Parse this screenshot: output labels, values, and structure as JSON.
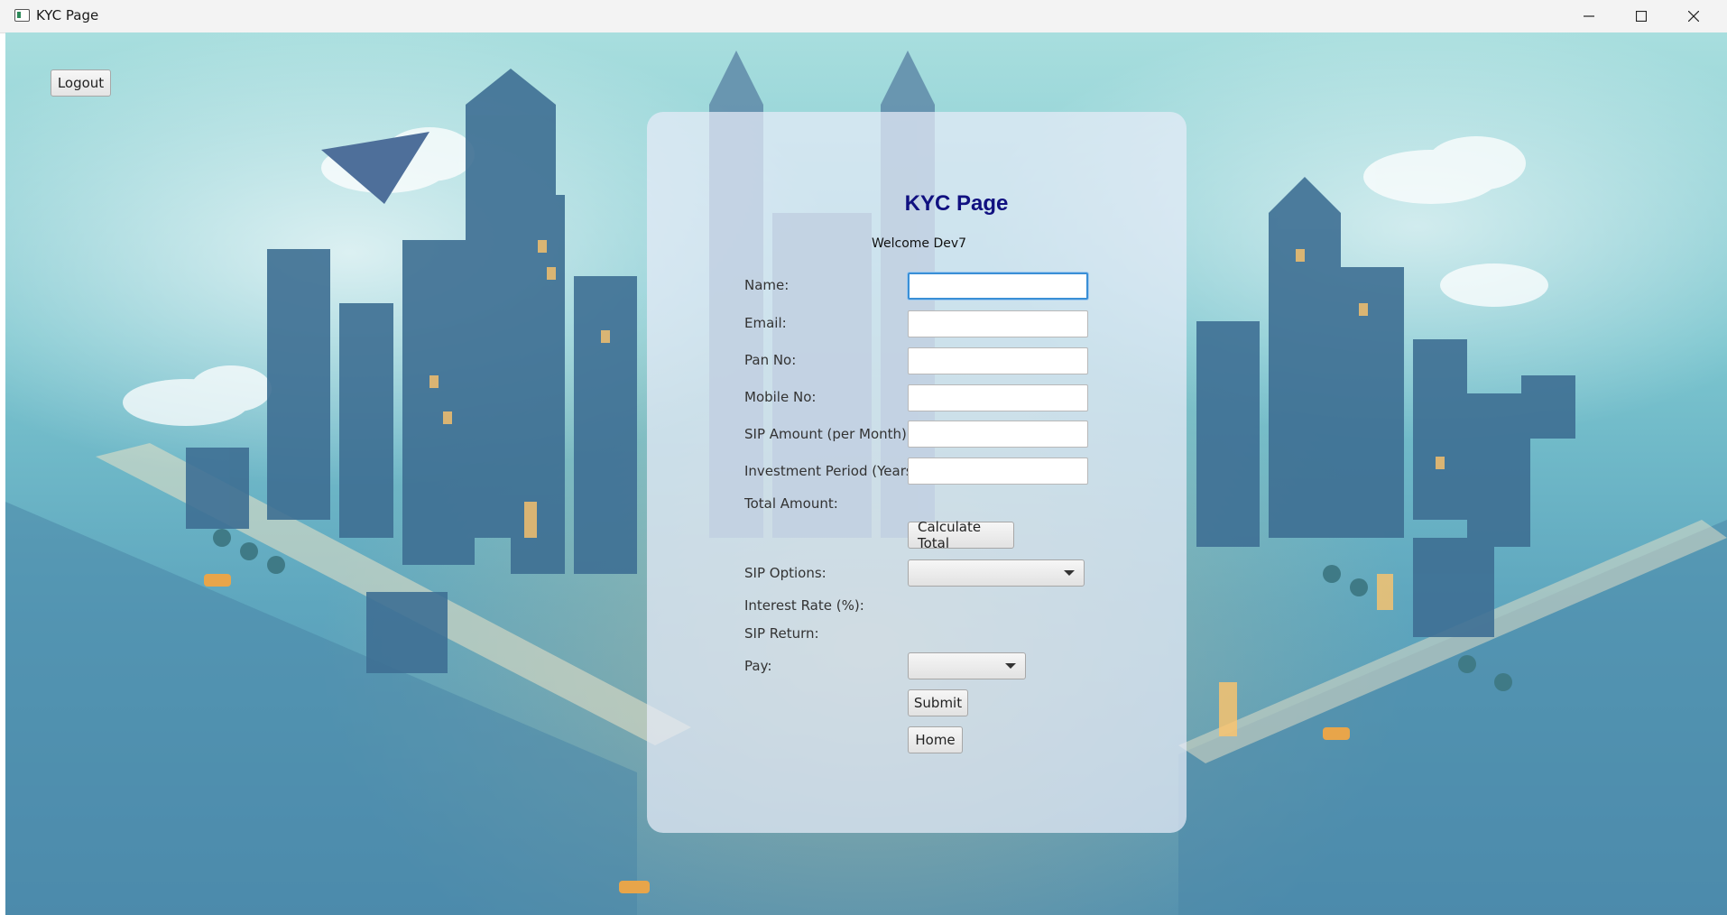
{
  "window": {
    "title": "KYC Page"
  },
  "header": {
    "logout_label": "Logout"
  },
  "form": {
    "title": "KYC Page",
    "welcome": "Welcome Dev7",
    "labels": {
      "name": "Name:",
      "email": "Email:",
      "pan": "Pan No:",
      "mobile": "Mobile No:",
      "sip_amount": "SIP Amount (per Month):",
      "investment_period": "Investment Period (Years):",
      "total_amount": "Total Amount:",
      "sip_options": "SIP Options:",
      "interest_rate": "Interest Rate (%):",
      "sip_return": "SIP Return:",
      "pay": "Pay:"
    },
    "values": {
      "name": "",
      "email": "",
      "pan": "",
      "mobile": "",
      "sip_amount": "",
      "investment_period": "",
      "sip_options": "",
      "pay": ""
    },
    "buttons": {
      "calculate_total": "Calculate Total",
      "submit": "Submit",
      "home": "Home"
    }
  },
  "colors": {
    "title": "#101080",
    "focus": "#3a8fd6",
    "panel": "#e8ebf8"
  }
}
